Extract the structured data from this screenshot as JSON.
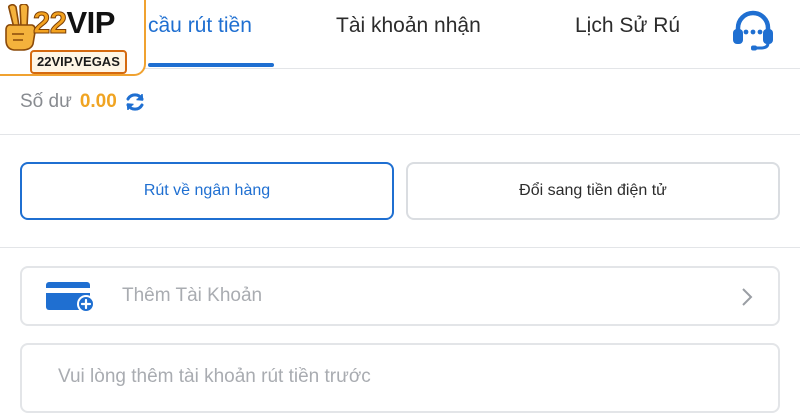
{
  "logo": {
    "brand_number": "22",
    "brand_suffix": "VIP",
    "domain": "22VIP.VEGAS"
  },
  "tabs": [
    {
      "label": "cầu rút tiền",
      "active": true
    },
    {
      "label": "Tài khoản nhận",
      "active": false
    },
    {
      "label": "Lịch Sử Rú",
      "active": false
    }
  ],
  "support": {
    "icon": "headset-icon"
  },
  "balance": {
    "label": "Số dư",
    "value": "0.00",
    "icon": "refresh-icon"
  },
  "methods": [
    {
      "label": "Rút về ngân hàng",
      "selected": true
    },
    {
      "label": "Đổi sang tiền điện tử",
      "selected": false
    }
  ],
  "add_account": {
    "label": "Thêm Tài Khoản",
    "icon": "card-add-icon",
    "chevron": "chevron-right-icon"
  },
  "hint": {
    "text": "Vui lòng thêm tài khoản rút tiền trước"
  },
  "colors": {
    "accent": "#1f6fd1",
    "balance": "#f0a422",
    "logo_orange": "#f3a21f",
    "border": "#e3e5e8"
  }
}
